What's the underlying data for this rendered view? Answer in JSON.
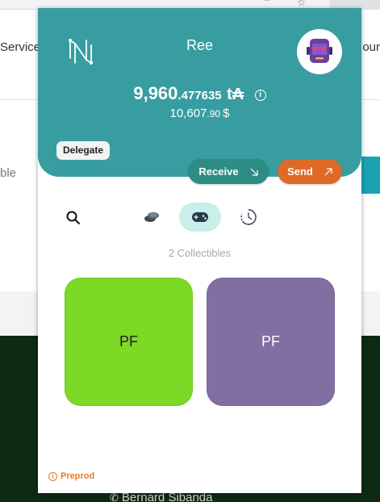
{
  "background_site": {
    "nav_left_text": "Service",
    "nav_right_text": "our",
    "content_text": "ble",
    "footer_contact_name": "Bernard Sibanda"
  },
  "wallet": {
    "account_name": "Ree",
    "balance": {
      "integer_part": "9,960",
      "decimal_part": ".477635",
      "currency_symbol": "t₳"
    },
    "fiat": {
      "integer_part": "10,607",
      "decimal_part": ".90",
      "currency_symbol": "$"
    },
    "delegate_label": "Delegate",
    "receive_label": "Receive",
    "send_label": "Send",
    "tabs": [
      {
        "name": "tokens",
        "icon": "coins-icon",
        "active": false
      },
      {
        "name": "collectibles",
        "icon": "gamepad-icon",
        "active": true
      },
      {
        "name": "activity",
        "icon": "clock-icon",
        "active": false
      }
    ],
    "collectibles_count_label": "2 Collectibles",
    "collectibles": [
      {
        "label": "PF",
        "color": "#7cd926"
      },
      {
        "label": "PF",
        "color": "#826fa2"
      }
    ],
    "network_label": "Preprod"
  },
  "colors": {
    "header_teal": "#389da1",
    "receive_button": "#2d8c84",
    "send_button": "#df6a26",
    "active_tab": "#c8efe9",
    "network_orange": "#df7a2b"
  }
}
